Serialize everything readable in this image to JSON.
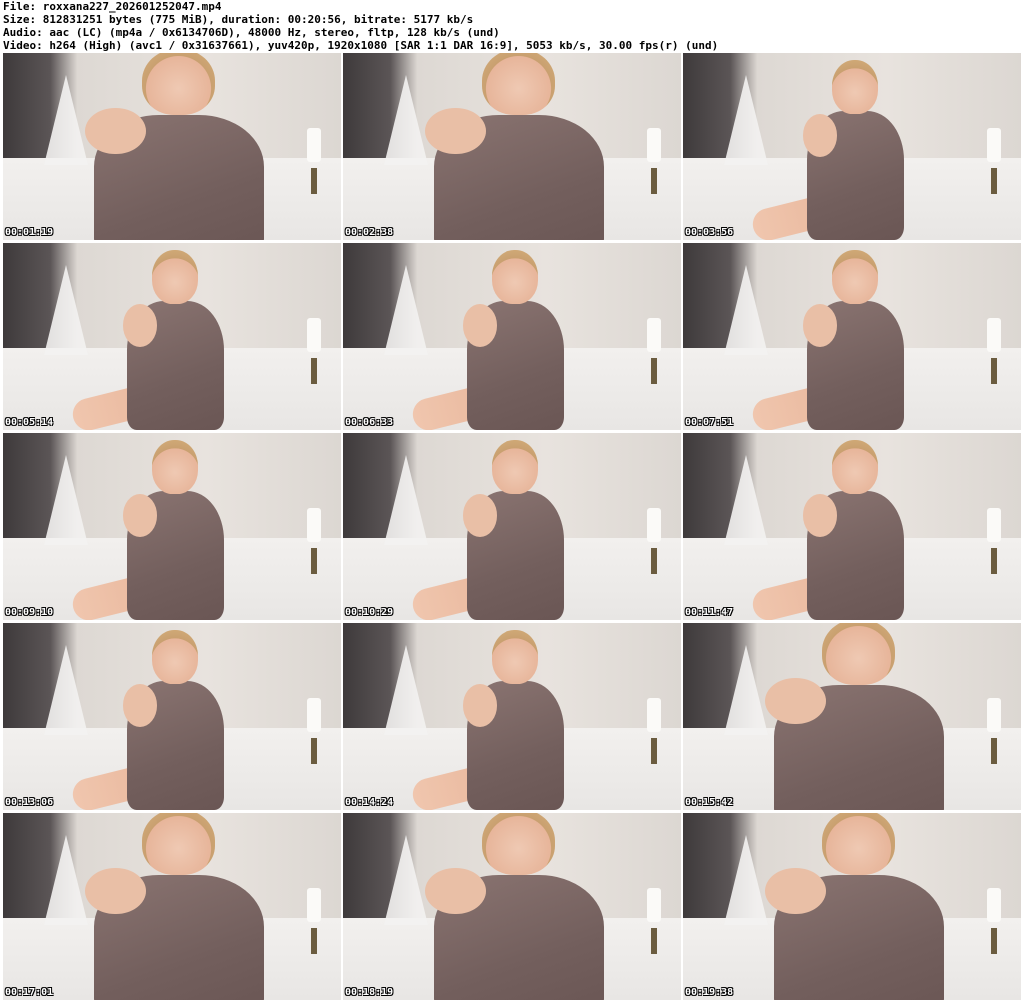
{
  "header": {
    "file_line": "File: roxxana227_202601252047.mp4",
    "size_line": "Size: 812831251 bytes (775 MiB), duration: 00:20:56, bitrate: 5177 kb/s",
    "audio_line": "Audio: aac (LC) (mp4a / 0x6134706D), 48000 Hz, stereo, fltp, 128 kb/s (und)",
    "video_line": "Video: h264 (High) (avc1 / 0x31637661), yuv420p, 1920x1080 [SAR 1:1 DAR 16:9], 5053 kb/s, 30.00 fps(r) (und)"
  },
  "thumbnails": [
    {
      "timestamp": "00:01:19"
    },
    {
      "timestamp": "00:02:38"
    },
    {
      "timestamp": "00:03:56"
    },
    {
      "timestamp": "00:05:14"
    },
    {
      "timestamp": "00:06:33"
    },
    {
      "timestamp": "00:07:51"
    },
    {
      "timestamp": "00:09:10"
    },
    {
      "timestamp": "00:10:29"
    },
    {
      "timestamp": "00:11:47"
    },
    {
      "timestamp": "00:13:06"
    },
    {
      "timestamp": "00:14:24"
    },
    {
      "timestamp": "00:15:42"
    },
    {
      "timestamp": "00:17:01"
    },
    {
      "timestamp": "00:18:19"
    },
    {
      "timestamp": "00:19:38"
    }
  ]
}
